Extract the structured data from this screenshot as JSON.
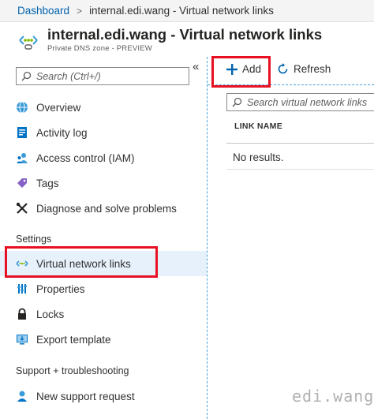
{
  "breadcrumb": {
    "root": "Dashboard",
    "separator": ">",
    "current": "internal.edi.wang - Virtual network links"
  },
  "header": {
    "title": "internal.edi.wang - Virtual network links",
    "subtitle": "Private DNS zone - PREVIEW",
    "icon": "private-dns-icon"
  },
  "sidebar": {
    "collapse_glyph": "«",
    "search_placeholder": "Search (Ctrl+/)",
    "items": [
      {
        "label": "Overview",
        "icon": "globe-icon"
      },
      {
        "label": "Activity log",
        "icon": "activity-log-icon"
      },
      {
        "label": "Access control (IAM)",
        "icon": "people-icon"
      },
      {
        "label": "Tags",
        "icon": "tag-icon"
      },
      {
        "label": "Diagnose and solve problems",
        "icon": "wrench-icon"
      }
    ],
    "settings_heading": "Settings",
    "settings_items": [
      {
        "label": "Virtual network links",
        "icon": "link-icon",
        "selected": true
      },
      {
        "label": "Properties",
        "icon": "properties-icon"
      },
      {
        "label": "Locks",
        "icon": "lock-icon"
      },
      {
        "label": "Export template",
        "icon": "export-icon"
      }
    ],
    "support_heading": "Support + troubleshooting",
    "support_items": [
      {
        "label": "New support request",
        "icon": "support-person-icon"
      }
    ]
  },
  "toolbar": {
    "add_label": "Add",
    "refresh_label": "Refresh"
  },
  "content": {
    "search_placeholder": "Search virtual network links",
    "column_header": "LINK NAME",
    "empty_text": "No results."
  },
  "watermark": "edi.wang",
  "colors": {
    "accent": "#0078d4",
    "highlight_box": "#e81123",
    "selected_bg": "#e6f1fb"
  }
}
